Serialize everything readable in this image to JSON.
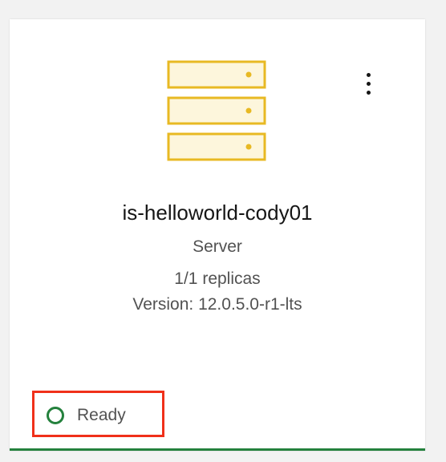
{
  "card": {
    "title": "is-helloworld-cody01",
    "type": "Server",
    "replicas": "1/1 replicas",
    "version": "Version: 12.0.5.0-r1-lts",
    "icon": "server-stack-icon",
    "menu_icon": "overflow-menu-vertical-icon"
  },
  "status": {
    "label": "Ready",
    "icon": "status-ring-icon"
  },
  "colors": {
    "icon_stroke": "#e8b923",
    "icon_fill": "#fdf6dc",
    "status_green": "#24813d",
    "highlight_red": "#f0301a",
    "accent": "#24813d"
  }
}
